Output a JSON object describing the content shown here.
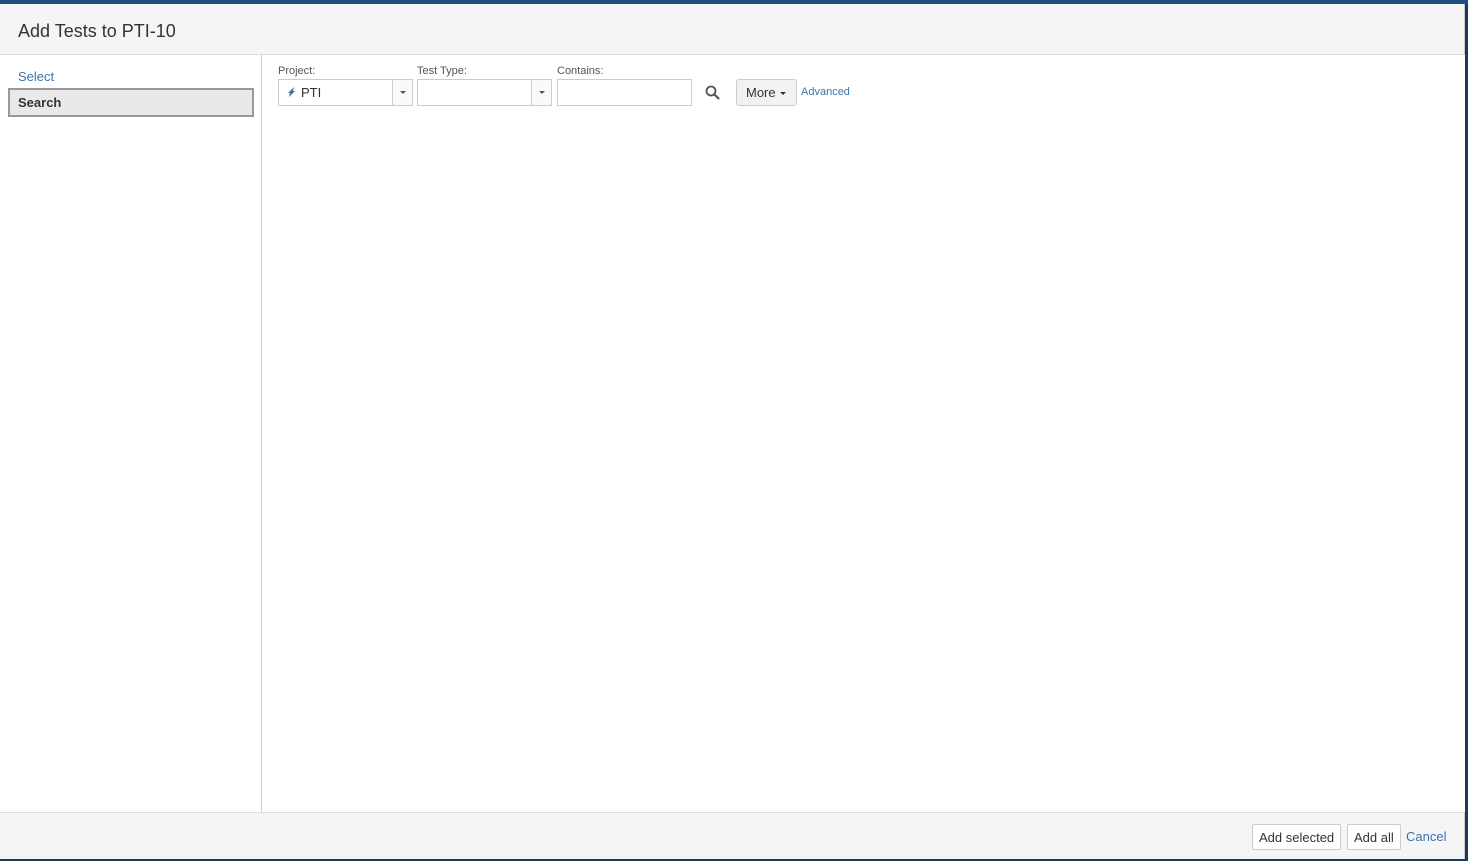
{
  "dialog": {
    "title": "Add Tests to PTI-10"
  },
  "sidebar": {
    "items": [
      {
        "label": "Select"
      },
      {
        "label": "Search"
      }
    ]
  },
  "filters": {
    "project_label": "Project:",
    "project_value": "PTI",
    "test_type_label": "Test Type:",
    "test_type_value": "",
    "contains_label": "Contains:",
    "contains_value": "",
    "more_label": "More",
    "advanced_label": "Advanced"
  },
  "footer": {
    "add_selected_label": "Add selected",
    "add_all_label": "Add all",
    "cancel_label": "Cancel"
  },
  "colors": {
    "link": "#3b73af",
    "header_bg": "#f5f5f5",
    "backdrop": "#1b3a5c"
  }
}
